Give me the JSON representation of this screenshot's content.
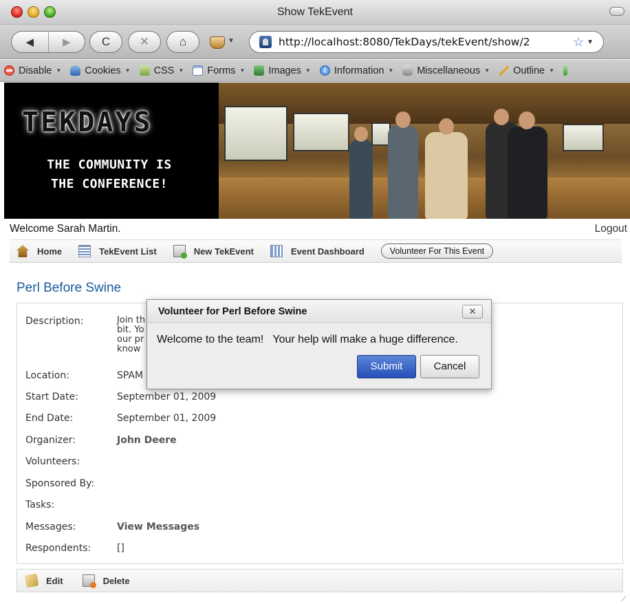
{
  "browser": {
    "window_title": "Show TekEvent",
    "url": "http://localhost:8080/TekDays/tekEvent/show/2",
    "back_glyph": "◀",
    "forward_glyph": "▶",
    "reload_glyph": "C",
    "stop_glyph": "✕",
    "home_glyph": "⌂",
    "star_glyph": "☆",
    "dropdown_glyph": "▼"
  },
  "dev_toolbar": {
    "items": [
      {
        "label": "Disable",
        "icon": "disable-icon"
      },
      {
        "label": "Cookies",
        "icon": "cookies-icon"
      },
      {
        "label": "CSS",
        "icon": "css-icon"
      },
      {
        "label": "Forms",
        "icon": "forms-icon"
      },
      {
        "label": "Images",
        "icon": "images-icon"
      },
      {
        "label": "Information",
        "icon": "information-icon"
      },
      {
        "label": "Miscellaneous",
        "icon": "miscellaneous-icon"
      },
      {
        "label": "Outline",
        "icon": "outline-icon"
      }
    ]
  },
  "banner": {
    "brand": "TEKDAYS",
    "tagline_line1": "THE COMMUNITY IS",
    "tagline_line2": "THE CONFERENCE!"
  },
  "header": {
    "welcome": "Welcome Sarah Martin.",
    "logout": "Logout"
  },
  "nav": {
    "home": "Home",
    "event_list": "TekEvent List",
    "new_event": "New TekEvent",
    "dashboard": "Event Dashboard",
    "volunteer": "Volunteer For This Event"
  },
  "event": {
    "title": "Perl Before Swine",
    "description_label": "Description:",
    "description_line1": "Join th                                                                                   r skills and ham it up a",
    "description_line2": "bit. Yo                                                                                   supply of pork chops in",
    "description_line3": "our pr                                                                                    Austin, Minnesota. You'll",
    "description_line4": "know",
    "location_label": "Location:",
    "location": "SPAM",
    "start_label": "Start Date:",
    "start_date": "September 01, 2009",
    "end_label": "End Date:",
    "end_date": "September 01, 2009",
    "organizer_label": "Organizer:",
    "organizer": "John Deere",
    "volunteers_label": "Volunteers:",
    "sponsored_label": "Sponsored By:",
    "tasks_label": "Tasks:",
    "messages_label": "Messages:",
    "messages_link": "View Messages",
    "respondents_label": "Respondents:",
    "respondents": "[]"
  },
  "footer": {
    "edit": "Edit",
    "delete": "Delete"
  },
  "dialog": {
    "title": "Volunteer for Perl Before Swine",
    "close_glyph": "✕",
    "message": "Welcome to the team!   Your help will make a huge difference.",
    "submit": "Submit",
    "cancel": "Cancel"
  }
}
